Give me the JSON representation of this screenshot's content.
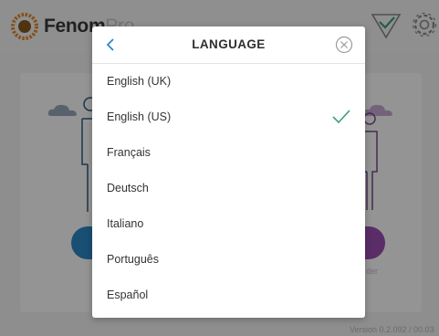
{
  "app": {
    "brand_main": "Fenom",
    "brand_suffix": "Pro",
    "version": "Version 0.2.092 / 00.03"
  },
  "background": {
    "partial_label": "der"
  },
  "modal": {
    "title": "LANGUAGE",
    "languages": [
      {
        "label": "English (UK)",
        "selected": false
      },
      {
        "label": "English (US)",
        "selected": true
      },
      {
        "label": "Français",
        "selected": false
      },
      {
        "label": "Deutsch",
        "selected": false
      },
      {
        "label": "Italiano",
        "selected": false
      },
      {
        "label": "Português",
        "selected": false
      },
      {
        "label": "Español",
        "selected": false
      }
    ]
  },
  "colors": {
    "accent_blue": "#2e88c8",
    "check_green": "#3ea07a",
    "brand_orange": "#e58a2c"
  },
  "icons": {
    "logo": "sunflower-logo",
    "header_check": "check-triangle-icon",
    "header_settings": "gear-icon",
    "back": "chevron-left-icon",
    "close": "close-circle-icon",
    "selected": "check-icon"
  }
}
